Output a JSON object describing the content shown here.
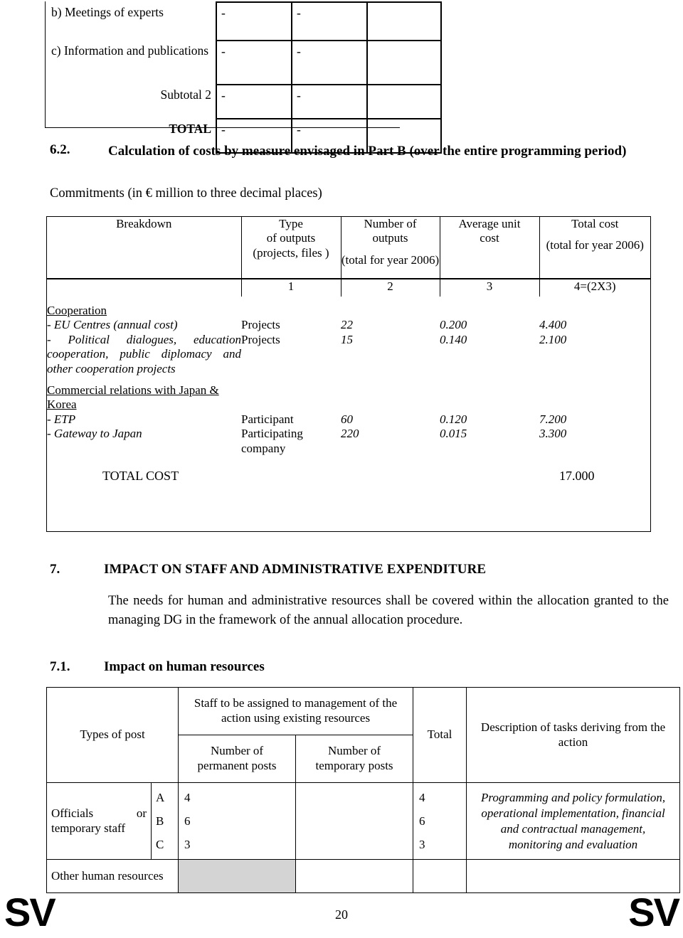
{
  "continuation_table": {
    "rows": [
      {
        "label": "b) Meetings of experts",
        "v1": "-",
        "v2": "-",
        "v3": ""
      },
      {
        "label": "c) Information and publications",
        "v1": "-",
        "v2": "-",
        "v3": ""
      },
      {
        "label": "Subtotal 2",
        "v1": "-",
        "v2": "-",
        "v3": ""
      },
      {
        "label": "TOTAL",
        "v1": "-",
        "v2": "-",
        "v3": ""
      }
    ]
  },
  "section_6_2": {
    "number": "6.2.",
    "title": "Calculation of costs by measure envisaged in Part B (over the entire programming period)",
    "commitments_note": "Commitments (in € million to three decimal places)"
  },
  "cost_table": {
    "headers": {
      "breakdown": "Breakdown",
      "type_of_outputs": "Type\nof outputs\n(projects, files )",
      "type_line1": "Type",
      "type_line2": "of outputs",
      "type_line3": "(projects, files )",
      "number_line1": "Number of",
      "number_line2": "outputs",
      "number_sub": "(total for year 2006)",
      "average_line1": "Average unit",
      "average_line2": "cost",
      "total_line1": "Total cost",
      "total_sub": "(total for year 2006)"
    },
    "column_numbers": [
      "1",
      "2",
      "3",
      "4=(2X3)"
    ],
    "groups": [
      {
        "title": "Cooperation",
        "rows": [
          {
            "label": "- EU Centres (annual cost)",
            "type": "Projects",
            "number": "22",
            "unit_cost": "0.200",
            "total": "4.400"
          },
          {
            "label": "- Political dialogues, education cooperation, public diplomacy and other cooperation projects",
            "type": "Projects",
            "number": "15",
            "unit_cost": "0.140",
            "total": "2.100"
          }
        ]
      },
      {
        "title": "Commercial relations with Japan & Korea",
        "rows": [
          {
            "label": "- ETP",
            "type": "Participant",
            "number": "60",
            "unit_cost": "0.120",
            "total": "7.200"
          },
          {
            "label": "- Gateway to Japan",
            "type": "Participating company",
            "number": "220",
            "unit_cost": "0.015",
            "total": "3.300"
          }
        ]
      }
    ],
    "total_row": {
      "label": "TOTAL COST",
      "value": "17.000"
    }
  },
  "section_7": {
    "number": "7.",
    "title": "IMPACT ON STAFF AND ADMINISTRATIVE EXPENDITURE",
    "paragraph": "The needs for human and administrative resources shall be covered within the allocation granted to the managing DG in the framework of the annual allocation procedure."
  },
  "section_7_1": {
    "number": "7.1.",
    "title": "Impact on human resources"
  },
  "hr_table": {
    "headers": {
      "types_of_post": "Types of post",
      "staff_assigned": "Staff to be assigned to management of the action using existing resources",
      "permanent_posts_l1": "Number of",
      "permanent_posts_l2": "permanent posts",
      "temporary_posts_l1": "Number of",
      "temporary_posts_l2": "temporary posts",
      "total": "Total",
      "description_l1": "Description of tasks deriving from the",
      "description_l2": "action"
    },
    "rows": [
      {
        "type_label_left": "Officials",
        "type_label_right": "or",
        "type_label_line2": "temporary staff",
        "grades": [
          "A",
          "B",
          "C"
        ],
        "permanent": [
          "4",
          "6",
          "3"
        ],
        "temporary": [
          "",
          "",
          ""
        ],
        "total": [
          "4",
          "6",
          "3"
        ],
        "description": "Programming and policy formulation, operational implementation, financial and contractual management, monitoring and evaluation"
      },
      {
        "type_label": "Other human resources",
        "permanent": "",
        "temporary": "",
        "total": "",
        "description": ""
      }
    ]
  },
  "footer": {
    "left_mark": "SV",
    "right_mark": "SV",
    "page_number": "20"
  }
}
